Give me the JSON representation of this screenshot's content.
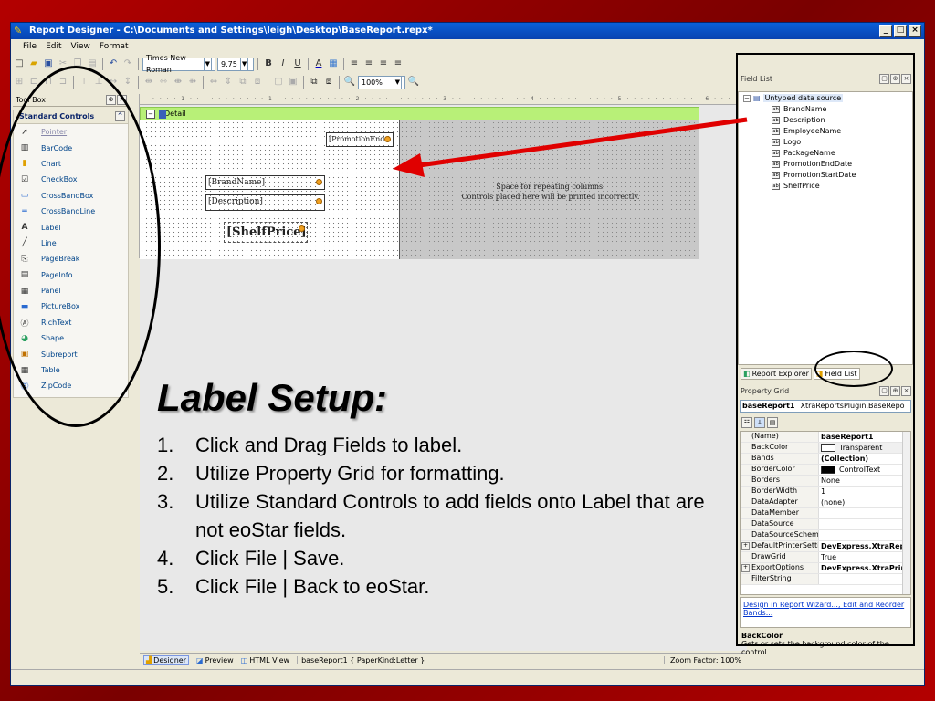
{
  "window": {
    "title": "Report Designer - C:\\Documents and Settings\\leigh\\Desktop\\BaseReport.repx*",
    "min_label": "_",
    "max_label": "□",
    "close_label": "×"
  },
  "menu": [
    "File",
    "Edit",
    "View",
    "Format"
  ],
  "toolbar": {
    "font_name": "Times New Roman",
    "font_size": "9.75",
    "zoom": "100%",
    "bold": "B",
    "italic": "I",
    "underline": "U"
  },
  "toolbox": {
    "title": "Tool Box",
    "group": "Standard Controls",
    "items": [
      {
        "label": "Pointer",
        "icon": "➚"
      },
      {
        "label": "BarCode",
        "icon": "▥"
      },
      {
        "label": "Chart",
        "icon": "▮"
      },
      {
        "label": "CheckBox",
        "icon": "☑"
      },
      {
        "label": "CrossBandBox",
        "icon": "▭"
      },
      {
        "label": "CrossBandLine",
        "icon": "═"
      },
      {
        "label": "Label",
        "icon": "A"
      },
      {
        "label": "Line",
        "icon": "╱"
      },
      {
        "label": "PageBreak",
        "icon": "⎘"
      },
      {
        "label": "PageInfo",
        "icon": "▤"
      },
      {
        "label": "Panel",
        "icon": "▦"
      },
      {
        "label": "PictureBox",
        "icon": "▬"
      },
      {
        "label": "RichText",
        "icon": "Ⓐ"
      },
      {
        "label": "Shape",
        "icon": "◕"
      },
      {
        "label": "Subreport",
        "icon": "▣"
      },
      {
        "label": "Table",
        "icon": "▦"
      },
      {
        "label": "ZipCode",
        "icon": "⓷"
      }
    ]
  },
  "design": {
    "ruler": "· · · · 1 · · · · · · · · · · · 1 · · · · · · · · · · · 2 · · · · · · · · · · · 3 · · · · · · · · · · · 4 · · · · · · · · · · · 5 · · · · · · · · · · · 6 · · · · · · · · · · · 7 · · · · ·",
    "band_label": "Detail",
    "fields": {
      "promotion": "[PromotionEnd",
      "brand": "[BrandName]",
      "description": "[Description]",
      "shelf": "[ShelfPrice]"
    },
    "gray_note_line1": "Space for repeating columns.",
    "gray_note_line2": "Controls placed here will be printed incorrectly."
  },
  "slide": {
    "title": "Label Setup:",
    "steps": [
      {
        "num": "1.",
        "text": "Click and Drag Fields to label."
      },
      {
        "num": "2.",
        "text": "Utilize Property Grid for formatting."
      },
      {
        "num": "3.",
        "text": "Utilize Standard Controls to add fields onto Label that are not eoStar fields."
      },
      {
        "num": "4.",
        "text": "Click File | Save."
      },
      {
        "num": "5.",
        "text": "Click File | Back to eoStar."
      }
    ]
  },
  "statusbar": {
    "designer": "Designer",
    "preview": "Preview",
    "html_view": "HTML View",
    "report_info": "baseReport1 { PaperKind:Letter }",
    "zoom_factor": "Zoom Factor: 100%"
  },
  "field_list": {
    "title": "Field List",
    "root": "Untyped data source",
    "fields": [
      "BrandName",
      "Description",
      "EmployeeName",
      "Logo",
      "PackageName",
      "PromotionEndDate",
      "PromotionStartDate",
      "ShelfPrice"
    ],
    "tab_explorer": "Report Explorer",
    "tab_fieldlist": "Field List"
  },
  "property_grid": {
    "title": "Property Grid",
    "object_name": "baseReport1",
    "object_type": "XtraReportsPlugin.BaseRepo",
    "rows": [
      {
        "key": "(Name)",
        "value": "baseReport1",
        "bold": true
      },
      {
        "key": "BackColor",
        "value": "Transparent",
        "swatch": "#ffffff"
      },
      {
        "key": "Bands",
        "value": "(Collection)",
        "bold": true
      },
      {
        "key": "BorderColor",
        "value": "ControlText",
        "swatch": "#000000"
      },
      {
        "key": "Borders",
        "value": "None"
      },
      {
        "key": "BorderWidth",
        "value": "1"
      },
      {
        "key": "DataAdapter",
        "value": "(none)"
      },
      {
        "key": "DataMember",
        "value": ""
      },
      {
        "key": "DataSource",
        "value": ""
      },
      {
        "key": "DataSourceSchema",
        "value": ""
      },
      {
        "key": "DefaultPrinterSettin",
        "value": "DevExpress.XtraRep",
        "bold": true,
        "expand": true
      },
      {
        "key": "DrawGrid",
        "value": "True"
      },
      {
        "key": "ExportOptions",
        "value": "DevExpress.XtraPrin",
        "bold": true,
        "expand": true
      },
      {
        "key": "FilterString",
        "value": ""
      }
    ],
    "link1": "Design in Report Wizard...",
    "link2": "Edit and Reorder Bands...",
    "desc_title": "BackColor",
    "desc_text": "Gets or sets the background color of the control."
  }
}
